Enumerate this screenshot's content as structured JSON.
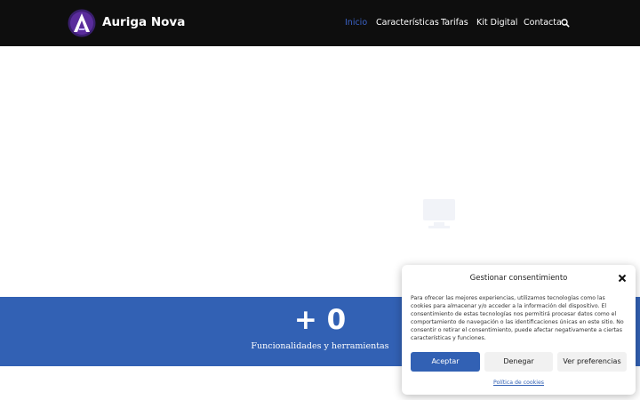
{
  "header": {
    "brand": "Auriga Nova",
    "nav": [
      {
        "label": "Inicio",
        "active": true
      },
      {
        "label": "Características",
        "active": false
      },
      {
        "label": "Tarifas",
        "active": false
      },
      {
        "label": "Kit Digital",
        "active": false
      },
      {
        "label": "Contacta",
        "active": false
      }
    ],
    "search_icon": "search-icon"
  },
  "stats": {
    "value": "+ 0",
    "label": "Funcionalidades y herramientas"
  },
  "consent": {
    "title": "Gestionar consentimiento",
    "body": "Para ofrecer las mejores experiencias, utilizamos tecnologías como las cookies para almacenar y/o acceder a la información del dispositivo. El consentimiento de estas tecnologías nos permitirá procesar datos como el comportamiento de navegación o las identificaciones únicas en este sitio. No consentir o retirar el consentimiento, puede afectar negativamente a ciertas características y funciones.",
    "accept": "Aceptar",
    "deny": "Denegar",
    "preferences": "Ver preferencias",
    "policy_link": "Política de cookies"
  },
  "colors": {
    "header_bg": "#0e0e0e",
    "accent": "#3261b4",
    "nav_active": "#3b63c8"
  }
}
